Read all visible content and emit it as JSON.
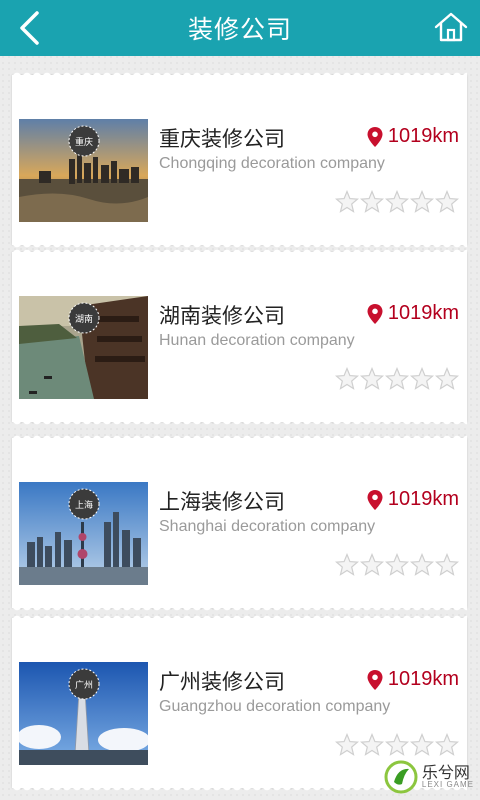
{
  "header": {
    "title": "装修公司",
    "back_icon": "chevron-left-icon",
    "home_icon": "home-icon"
  },
  "colors": {
    "header_bg": "#1aa3b0",
    "distance_text": "#b3001e",
    "subtitle_text": "#9a9a9a"
  },
  "companies": [
    {
      "name": "重庆装修公司",
      "subtitle": "Chongqing decoration company",
      "distance": "1019km",
      "rating": 0,
      "badge_text": "重庆"
    },
    {
      "name": "湖南装修公司",
      "subtitle": "Hunan decoration company",
      "distance": "1019km",
      "rating": 0,
      "badge_text": "湖南"
    },
    {
      "name": "上海装修公司",
      "subtitle": "Shanghai decoration company",
      "distance": "1019km",
      "rating": 0,
      "badge_text": "上海"
    },
    {
      "name": "广州装修公司",
      "subtitle": "Guangzhou decoration company",
      "distance": "1019km",
      "rating": 0,
      "badge_text": "广州"
    }
  ],
  "watermark": {
    "cn": "乐兮网",
    "en": "LEXI GAME"
  }
}
